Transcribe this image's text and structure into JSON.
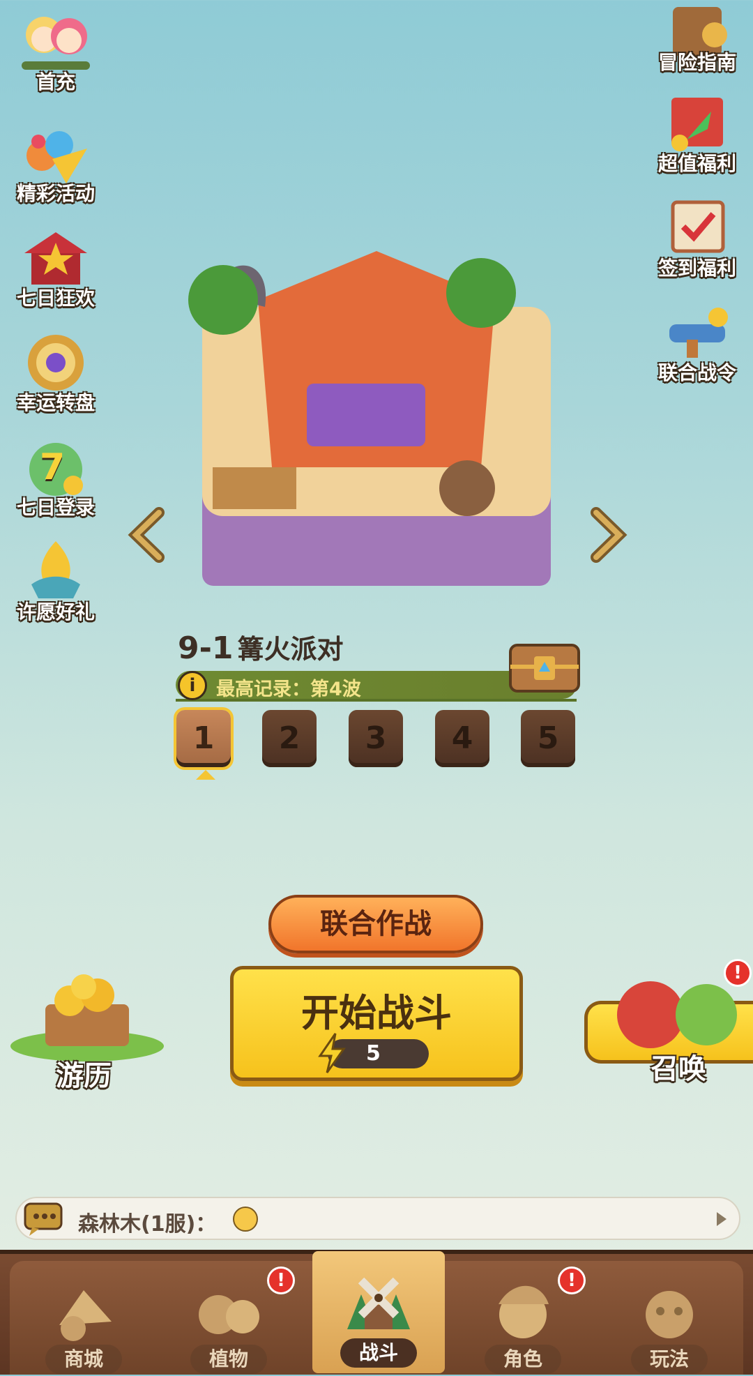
{
  "left_menu": [
    {
      "label": "首充"
    },
    {
      "label": "精彩活动"
    },
    {
      "label": "七日狂欢"
    },
    {
      "label": "幸运转盘"
    },
    {
      "label": "七日登录",
      "day": "7"
    },
    {
      "label": "许愿好礼"
    }
  ],
  "right_menu": [
    {
      "label": "冒险指南"
    },
    {
      "label": "超值福利"
    },
    {
      "label": "签到福利"
    },
    {
      "label": "联合战令"
    }
  ],
  "stage": {
    "number": "9-1",
    "name": "篝火派对",
    "record": "最高记录：第4波",
    "info_glyph": "i",
    "waves": [
      "1",
      "2",
      "3",
      "4",
      "5"
    ],
    "selected_wave": "1"
  },
  "buttons": {
    "coop": "联合作战",
    "start": "开始战斗",
    "energy_cost": "5",
    "travel": "游历",
    "summon": "召唤"
  },
  "badge_text": "!",
  "chat": {
    "message": "森林木(1服)："
  },
  "nav": [
    {
      "label": "商城",
      "badge": false
    },
    {
      "label": "植物",
      "badge": true
    },
    {
      "label": "战斗",
      "badge": false,
      "active": true
    },
    {
      "label": "角色",
      "badge": true
    },
    {
      "label": "玩法",
      "badge": false
    }
  ],
  "colors": {
    "accent_yellow": "#f6c21c",
    "accent_orange": "#f1752b",
    "nav_brown": "#6f4329",
    "badge_red": "#e5322b"
  }
}
